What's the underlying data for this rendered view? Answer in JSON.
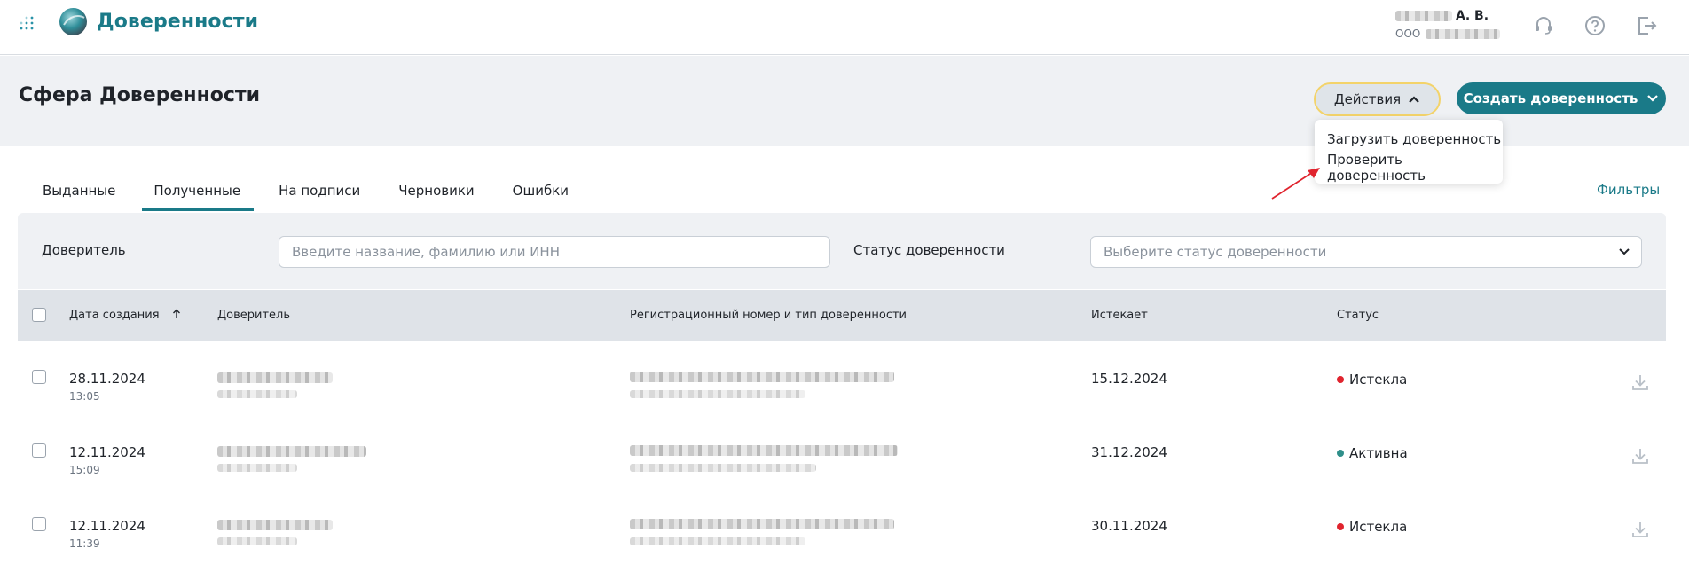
{
  "app": {
    "title": "Доверенности"
  },
  "user": {
    "name": "А. В.",
    "org_prefix": "ООО"
  },
  "page": {
    "title": "Сфера Доверенности"
  },
  "actions": {
    "actions_label": "Действия",
    "create_label": "Создать доверенность",
    "menu": [
      "Загрузить доверенность",
      "Проверить доверенность"
    ]
  },
  "tabs": [
    "Выданные",
    "Полученные",
    "На подписи",
    "Черновики",
    "Ошибки"
  ],
  "active_tab": "Полученные",
  "filters_link": "Фильтры",
  "filters": {
    "principal_label": "Доверитель",
    "principal_placeholder": "Введите название, фамилию или ИНН",
    "status_label": "Статус доверенности",
    "status_placeholder": "Выберите статус доверенности"
  },
  "table": {
    "headers": [
      "Дата создания",
      "Доверитель",
      "Регистрационный номер и тип доверенности",
      "Истекает",
      "Статус"
    ],
    "rows": [
      {
        "date": "28.11.2024",
        "time": "13:05",
        "expires": "15.12.2024",
        "status": "Истекла"
      },
      {
        "date": "12.11.2024",
        "time": "15:09",
        "expires": "31.12.2024",
        "status": "Активна"
      },
      {
        "date": "12.11.2024",
        "time": "11:39",
        "expires": "30.11.2024",
        "status": "Истекла"
      }
    ]
  },
  "colors": {
    "brand": "#1a7a88",
    "status_expired": "#e0242e",
    "status_active": "#2f8f8a",
    "highlight": "#f3d36a",
    "annotation_arrow": "#e0242e"
  }
}
